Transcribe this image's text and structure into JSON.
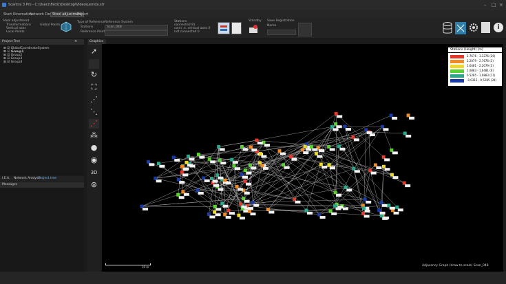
{
  "window": {
    "title": "Scantra 3 Pro - C:\\User2\\Fedic\\Desktop\\Video\\Lernda.str"
  },
  "menu": {
    "items": [
      "Start",
      "Kinematics",
      "Network Design",
      "Stool adjustment",
      "Export"
    ],
    "active_index": 3
  },
  "ribbon": {
    "group1_title": "Stool adjustment",
    "group1_items": [
      "Transformations",
      "Vertical axes",
      "Local Points"
    ],
    "global_points": "Global Points",
    "ref_title": "Type of Reference",
    "ref_stations": "Stations",
    "ref_points": "Reference Points",
    "refsys_title": "Reference System",
    "refsys_value": "Scan_048",
    "stations_title": "Stations",
    "stations_lines": [
      "connected 81",
      "conn. n. vertical axes 0",
      "not connected 0"
    ],
    "standby": "Standby",
    "save_reg": "Save Registration",
    "name_label": "Name"
  },
  "project": {
    "title": "Project Tree",
    "items": [
      {
        "label": "GlobalCoordinateSystem",
        "bold": false
      },
      {
        "label": "Group1",
        "bold": true
      },
      {
        "label": "Group2",
        "bold": false
      },
      {
        "label": "Group3",
        "bold": false
      },
      {
        "label": "Group4",
        "bold": false
      }
    ],
    "tabs": [
      "I.E.A.",
      "Network Analysis",
      "Project tree"
    ]
  },
  "messages": {
    "title": "Messages"
  },
  "graphics": {
    "tab": "Graphics",
    "caption": "Adjacency Graph (draw to scale) Scan_048",
    "scale_label": "10 m"
  },
  "legend": {
    "title": "Stations (Height) [m]",
    "rows": [
      {
        "color": "#e23b2e",
        "label": "2.7676 - 3.3276 (26)"
      },
      {
        "color": "#f08a24",
        "label": "2.2079 - 2.7676 (3)"
      },
      {
        "color": "#ecd82a",
        "label": "1.6481 - 2.2079 (3)"
      },
      {
        "color": "#5ad130",
        "label": "1.0883 - 1.6481 (6)"
      },
      {
        "color": "#2aa889",
        "label": "0.5285 - 1.0883 (11)"
      },
      {
        "color": "#1a3aa8",
        "label": "-0.0313 - 0.5285 (39)"
      }
    ]
  },
  "tools": [
    "cursor",
    "select",
    "rotate",
    "frame",
    "graph1",
    "graph2",
    "graph3",
    "nodes",
    "globe",
    "eye",
    "3D",
    "grid"
  ]
}
